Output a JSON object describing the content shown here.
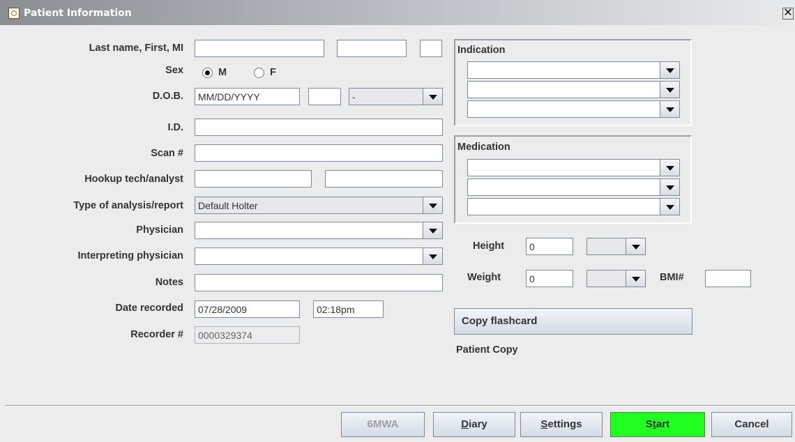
{
  "window": {
    "title": "Patient Information",
    "close_glyph": "✕",
    "icon": "java-cup-icon"
  },
  "form": {
    "name_label": "Last name, First, MI",
    "sex_label": "Sex",
    "sex_options": [
      "M",
      "F"
    ],
    "sex_selected": "M",
    "dob_label": "D.O.B.",
    "dob_value": "MM/DD/YYYY",
    "dob_unit_value": "-",
    "id_label": "I.D.",
    "scan_label": "Scan #",
    "hookup_label": "Hookup tech/analyst",
    "analysis_label": "Type of analysis/report",
    "analysis_value": "Default Holter",
    "physician_label": "Physician",
    "interp_label": "Interpreting physician",
    "notes_label": "Notes",
    "date_label": "Date recorded",
    "date_value": "07/28/2009",
    "time_value": "02:18pm",
    "recorder_label": "Recorder #",
    "recorder_value": "0000329374"
  },
  "indication": {
    "title": "Indication"
  },
  "medication": {
    "title": "Medication"
  },
  "body": {
    "height_label": "Height",
    "height_value": "0",
    "weight_label": "Weight",
    "weight_value": "0",
    "bmi_label": "BMI#"
  },
  "flashcard": {
    "button_label": "Copy flashcard",
    "status_text": "Patient Copy"
  },
  "footer": {
    "btn_6mwa": "6MWA",
    "btn_diary_first": "D",
    "btn_diary_rest": "iary",
    "btn_settings_first": "S",
    "btn_settings_rest": "ettings",
    "btn_start_a": "S",
    "btn_start_b": "t",
    "btn_start_c": "art",
    "btn_cancel": "Cancel"
  },
  "colors": {
    "start_button": "#20ff20",
    "window_bg": "#ececec"
  }
}
